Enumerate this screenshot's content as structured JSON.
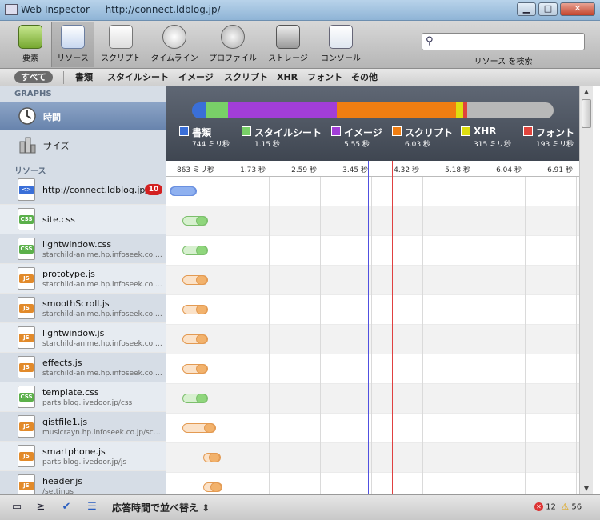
{
  "window": {
    "title": "Web Inspector — http://connect.ldblog.jp/"
  },
  "toolbar": {
    "tools": [
      {
        "label": "要素",
        "icon": "elements-icon"
      },
      {
        "label": "リソース",
        "icon": "resources-icon"
      },
      {
        "label": "スクリプト",
        "icon": "scripts-icon"
      },
      {
        "label": "タイムライン",
        "icon": "timeline-icon"
      },
      {
        "label": "プロファイル",
        "icon": "profiles-icon"
      },
      {
        "label": "ストレージ",
        "icon": "storage-icon"
      },
      {
        "label": "コンソール",
        "icon": "console-icon"
      }
    ],
    "search_label": "リソース を検索",
    "search_value": ""
  },
  "filters": [
    "すべて",
    "書類",
    "スタイルシート",
    "イメージ",
    "スクリプト",
    "XHR",
    "フォント",
    "その他"
  ],
  "sidebar": {
    "graphs_header": "GRAPHS",
    "graphs": [
      {
        "label": "時間",
        "icon": "clock-icon"
      },
      {
        "label": "サイズ",
        "icon": "size-icon"
      }
    ],
    "resources_header": "リソース",
    "resources": [
      {
        "name": "http://connect.ldblog.jp/",
        "sub": "",
        "type": "doc",
        "badge": "10"
      },
      {
        "name": "site.css",
        "sub": "",
        "type": "CSS"
      },
      {
        "name": "lightwindow.css",
        "sub": "starchild-anime.hp.infoseek.co.jp/css",
        "type": "CSS"
      },
      {
        "name": "prototype.js",
        "sub": "starchild-anime.hp.infoseek.co.jp/js",
        "type": "JS"
      },
      {
        "name": "smoothScroll.js",
        "sub": "starchild-anime.hp.infoseek.co.jp/js",
        "type": "JS"
      },
      {
        "name": "lightwindow.js",
        "sub": "starchild-anime.hp.infoseek.co.jp/js",
        "type": "JS"
      },
      {
        "name": "effects.js",
        "sub": "starchild-anime.hp.infoseek.co.jp/js",
        "type": "JS"
      },
      {
        "name": "template.css",
        "sub": "parts.blog.livedoor.jp/css",
        "type": "CSS"
      },
      {
        "name": "gistfile1.js",
        "sub": "musicrayn.hp.infoseek.co.jp/script",
        "type": "JS"
      },
      {
        "name": "smartphone.js",
        "sub": "parts.blog.livedoor.jp/js",
        "type": "JS"
      },
      {
        "name": "header.js",
        "sub": "/settings",
        "type": "JS"
      }
    ]
  },
  "graph": {
    "legend": [
      {
        "name": "書類",
        "value": "744 ミリ秒",
        "color": "#3a6fd8"
      },
      {
        "name": "スタイルシート",
        "value": "1.15 秒",
        "color": "#79d068"
      },
      {
        "name": "イメージ",
        "value": "5.55 秒",
        "color": "#a23ed8"
      },
      {
        "name": "スクリプト",
        "value": "6.03 秒",
        "color": "#f07e12"
      },
      {
        "name": "XHR",
        "value": "315 ミリ秒",
        "color": "#dede10"
      },
      {
        "name": "フォント",
        "value": "193 ミリ秒",
        "color": "#e0443c"
      }
    ],
    "bar_fractions": [
      0.04,
      0.06,
      0.3,
      0.33,
      0.02,
      0.01,
      0.24
    ]
  },
  "ruler": [
    "863 ミリ秒",
    "1.73 秒",
    "2.59 秒",
    "3.45 秒",
    "4.32 秒",
    "5.18 秒",
    "6.04 秒",
    "6.91 秒"
  ],
  "status": {
    "sort_label": "応答時間で並べ替え",
    "errors": "12",
    "warnings": "56"
  }
}
